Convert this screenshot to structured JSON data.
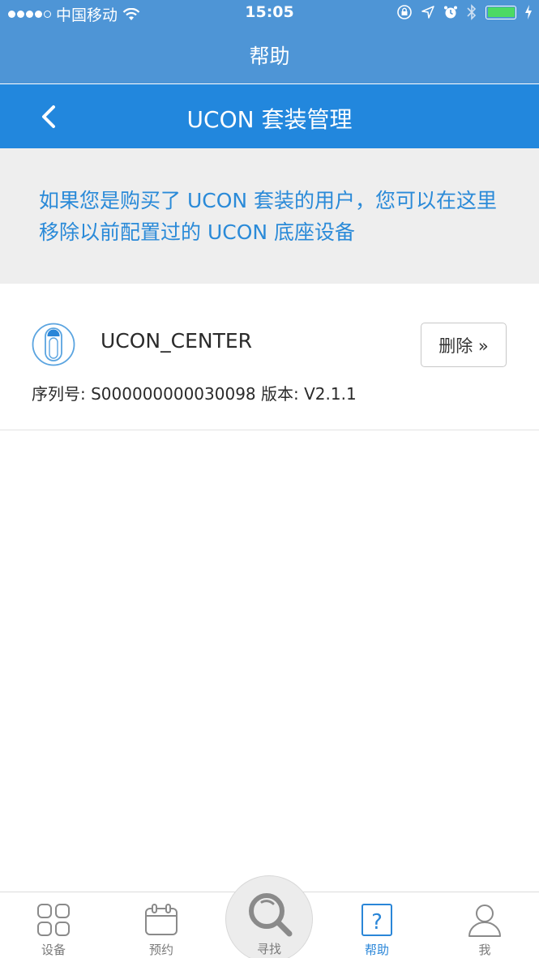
{
  "status_bar": {
    "carrier": "中国移动",
    "time": "15:05"
  },
  "nav": {
    "title": "帮助"
  },
  "header": {
    "title": "UCON 套装管理"
  },
  "info": {
    "text": "如果您是购买了 UCON 套装的用户，您可以在这里移除以前配置过的 UCON 底座设备"
  },
  "device": {
    "name": "UCON_CENTER",
    "delete_label": "删除 »",
    "meta": "序列号: S000000000030098 版本: V2.1.1"
  },
  "tabs": [
    {
      "label": "设备",
      "icon": "grid-icon"
    },
    {
      "label": "预约",
      "icon": "calendar-icon"
    },
    {
      "label": "寻找",
      "icon": "search-icon"
    },
    {
      "label": "帮助",
      "icon": "help-icon"
    },
    {
      "label": "我",
      "icon": "user-icon"
    }
  ],
  "colors": {
    "nav_bg": "#4e95d6",
    "header_bg": "#2287dd",
    "accent": "#2a8ad8",
    "battery": "#4cd964"
  }
}
